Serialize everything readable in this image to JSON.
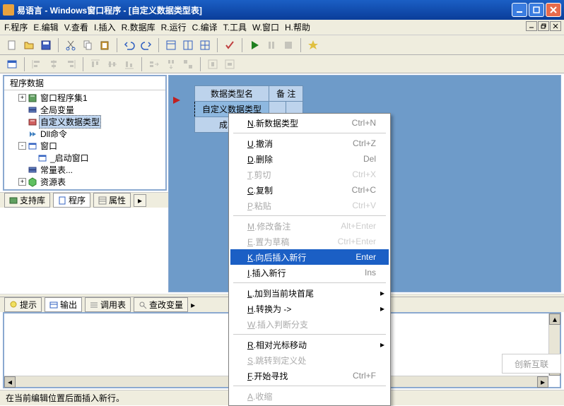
{
  "title": "易语言 - Windows窗口程序 - [自定义数据类型表]",
  "menu": {
    "file": "F.程序",
    "edit": "E.编辑",
    "view": "V.查看",
    "insert": "I.插入",
    "db": "R.数据库",
    "run": "R.运行",
    "compile": "C.编译",
    "tools": "T.工具",
    "window": "W.窗口",
    "help": "H.帮助"
  },
  "tree": {
    "root": "程序数据",
    "items": [
      {
        "label": "窗口程序集1",
        "lvl": 1,
        "exp": "+",
        "icon": "book"
      },
      {
        "label": "全局变量",
        "lvl": 1,
        "exp": "",
        "icon": "stack"
      },
      {
        "label": "自定义数据类型",
        "lvl": 1,
        "exp": "",
        "icon": "type",
        "sel": true
      },
      {
        "label": "Dll命令",
        "lvl": 1,
        "exp": "",
        "icon": "arrow"
      },
      {
        "label": "窗口",
        "lvl": 1,
        "exp": "-",
        "icon": "window"
      },
      {
        "label": "_启动窗口",
        "lvl": 2,
        "exp": "",
        "icon": "window"
      },
      {
        "label": "常量表...",
        "lvl": 1,
        "exp": "",
        "icon": "stack"
      },
      {
        "label": "资源表",
        "lvl": 1,
        "exp": "+",
        "icon": "cube"
      }
    ]
  },
  "lefttabs": {
    "support": "支持库",
    "program": "程序",
    "property": "属性"
  },
  "table": {
    "col1": "数据类型名",
    "col2": "备 注",
    "row1": "自定义数据类型",
    "row2": "成员名"
  },
  "contextmenu": [
    {
      "label": "N.新数据类型",
      "shortcut": "Ctrl+N",
      "type": "item"
    },
    {
      "type": "sep"
    },
    {
      "label": "U.撤消",
      "shortcut": "Ctrl+Z",
      "type": "item"
    },
    {
      "label": "D.删除",
      "shortcut": "Del",
      "type": "item"
    },
    {
      "label": "T.剪切",
      "shortcut": "Ctrl+X",
      "type": "item",
      "disabled": true
    },
    {
      "label": "C.复制",
      "shortcut": "Ctrl+C",
      "type": "item"
    },
    {
      "label": "P.粘贴",
      "shortcut": "Ctrl+V",
      "type": "item",
      "disabled": true
    },
    {
      "type": "sep"
    },
    {
      "label": "M.修改备注",
      "shortcut": "Alt+Enter",
      "type": "item",
      "disabled": true
    },
    {
      "label": "E.置为草稿",
      "shortcut": "Ctrl+Enter",
      "type": "item",
      "disabled": true
    },
    {
      "label": "K.向后插入新行",
      "shortcut": "Enter",
      "type": "item",
      "highlight": true
    },
    {
      "label": "I.插入新行",
      "shortcut": "Ins",
      "type": "item"
    },
    {
      "type": "sep"
    },
    {
      "label": "L.加到当前块首尾",
      "shortcut": "",
      "type": "item",
      "sub": true
    },
    {
      "label": "H.转换为 ->",
      "shortcut": "",
      "type": "item",
      "sub": true
    },
    {
      "label": "W.插入判断分支",
      "shortcut": "",
      "type": "item",
      "disabled": true
    },
    {
      "type": "sep"
    },
    {
      "label": "R.相对光标移动",
      "shortcut": "",
      "type": "item",
      "sub": true
    },
    {
      "label": "S.跳转到定义处",
      "shortcut": "",
      "type": "item",
      "disabled": true
    },
    {
      "label": "F.开始寻找",
      "shortcut": "Ctrl+F",
      "type": "item"
    },
    {
      "type": "sep"
    },
    {
      "label": "A.收缩",
      "shortcut": "",
      "type": "item",
      "disabled": true
    }
  ],
  "bottomtabs": {
    "tip": "提示",
    "output": "输出",
    "trace": "调用表",
    "vars": "查改变量"
  },
  "status": "在当前编辑位置后面插入新行。",
  "logo": "创新互联"
}
